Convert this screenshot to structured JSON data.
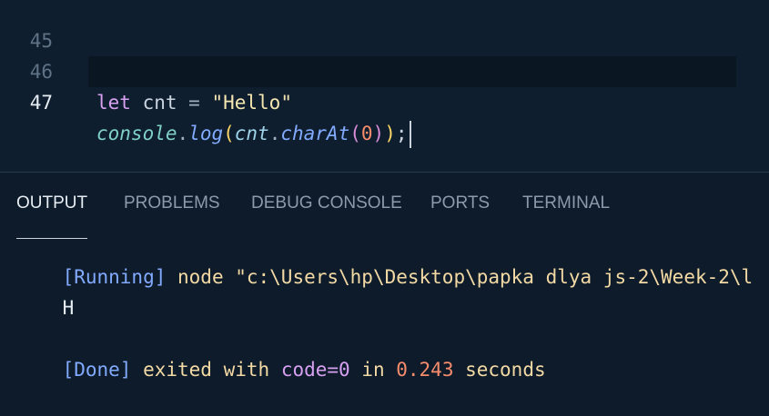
{
  "editor": {
    "lines": [
      {
        "number": "45",
        "tokens": []
      },
      {
        "number": "46",
        "tokens": [
          {
            "text": "let",
            "cls": "kw"
          },
          {
            "text": " cnt ",
            "cls": "var"
          },
          {
            "text": "=",
            "cls": "op"
          },
          {
            "text": " ",
            "cls": "var"
          },
          {
            "text": "\"Hello\"",
            "cls": "str"
          }
        ]
      },
      {
        "number": "47",
        "tokens": [
          {
            "text": "console",
            "cls": "obj"
          },
          {
            "text": ".",
            "cls": "dot"
          },
          {
            "text": "log",
            "cls": "fn"
          },
          {
            "text": "(",
            "cls": "paren1"
          },
          {
            "text": "cnt",
            "cls": "param"
          },
          {
            "text": ".",
            "cls": "dot"
          },
          {
            "text": "charAt",
            "cls": "fn"
          },
          {
            "text": "(",
            "cls": "paren2"
          },
          {
            "text": "0",
            "cls": "num"
          },
          {
            "text": ")",
            "cls": "paren2"
          },
          {
            "text": ")",
            "cls": "paren1"
          },
          {
            "text": ";",
            "cls": "punc"
          }
        ]
      }
    ]
  },
  "panel": {
    "tabs": [
      {
        "label": "OUTPUT",
        "active": true
      },
      {
        "label": "PROBLEMS",
        "active": false
      },
      {
        "label": "DEBUG CONSOLE",
        "active": false
      },
      {
        "label": "PORTS",
        "active": false
      },
      {
        "label": "TERMINAL",
        "active": false
      }
    ],
    "output": {
      "running_tag": "[Running]",
      "running_cmd": " node \"c:\\Users\\hp\\Desktop\\papka dlya js-2\\Week-2\\l",
      "result": "H",
      "done_tag": "[Done]",
      "done_text1": " exited with ",
      "done_code": "code=0",
      "done_text2": " in ",
      "done_time": "0.243",
      "done_text3": " seconds"
    }
  },
  "colors": {
    "background": "#0d1b2a",
    "editor_background": "#0f1e2e",
    "keyword": "#d7a0f0",
    "string": "#f3e6b0",
    "function": "#82aaff",
    "number": "#f78c6c"
  }
}
